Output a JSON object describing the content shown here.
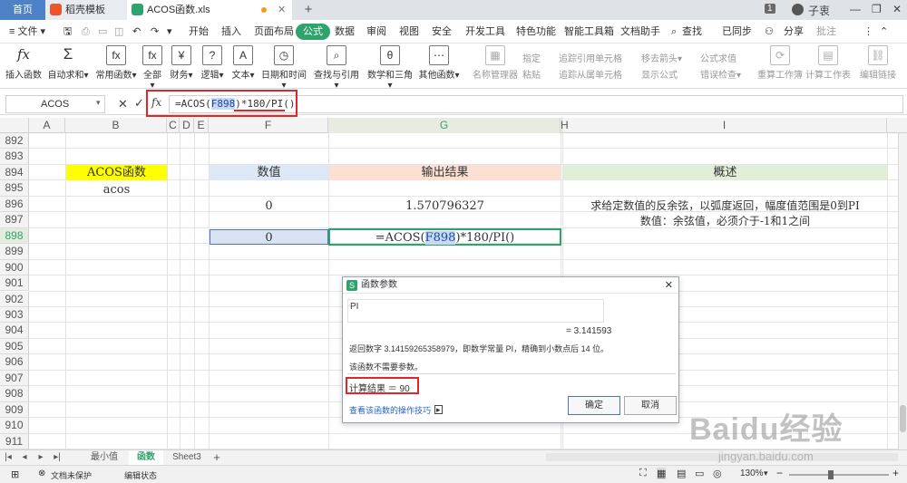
{
  "tabs": {
    "home": "首页",
    "template": "稻壳模板",
    "file": "ACOS函数.xls",
    "add": "+"
  },
  "window": {
    "page_num": "1",
    "user": "子衷"
  },
  "menu": {
    "file": "≡ 文件 ▾",
    "items": [
      "开始",
      "插入",
      "页面布局",
      "公式",
      "数据",
      "审阅",
      "视图",
      "安全",
      "开发工具",
      "特色功能",
      "智能工具箱",
      "文档助手"
    ],
    "active": "公式",
    "search": "查找",
    "sync": "已同步",
    "share": "分享",
    "comment": "批注"
  },
  "ribbon": {
    "buttons": [
      "插入函数",
      "自动求和▾",
      "常用函数▾",
      "全部▾",
      "财务▾",
      "逻辑▾",
      "文本▾",
      "日期和时间▾",
      "查找与引用▾",
      "数学和三角▾",
      "其他函数▾"
    ],
    "name_manager": "名称管理器",
    "paste": "粘贴",
    "specify": "指定",
    "trace_precedents": "追踪引用单元格",
    "trace_dependents": "追踪从属单元格",
    "remove_arrows": "移去箭头▾",
    "show_formula": "显示公式",
    "formula_eval": "公式求值",
    "error_check": "错误检查▾",
    "recalc_book": "重算工作簿",
    "calc_sheet": "计算工作表",
    "edit_links": "编辑链接"
  },
  "formula_bar": {
    "namebox": "ACOS",
    "fx": "fx",
    "formula_prefix": "=ACOS(",
    "formula_ref": "F898",
    "formula_suffix": ")*180/PI()"
  },
  "columns": [
    "A",
    "B",
    "C",
    "D",
    "E",
    "F",
    "G",
    "H",
    "I"
  ],
  "rows": [
    "892",
    "893",
    "894",
    "895",
    "896",
    "897",
    "898",
    "899",
    "900",
    "901",
    "902",
    "903",
    "904",
    "905",
    "906",
    "907",
    "908",
    "909",
    "910",
    "911"
  ],
  "cells": {
    "b894": "ACOS函数",
    "b895": "acos",
    "f894": "数值",
    "g894": "输出结果",
    "i894": "概述",
    "f896": "0",
    "g896": "1.570796327",
    "i896": "求给定数值的反余弦，以弧度返回，幅度值范围是0到PI",
    "i897": "数值：余弦值，必须介于-1和1之间",
    "f898": "0",
    "g898_prefix": "=ACOS(",
    "g898_ref": "F898",
    "g898_suffix": ")*180/PI()"
  },
  "dialog": {
    "title": "函数参数",
    "arg_label": "PI",
    "arg_value": "= 3.141593",
    "desc": "返回数字 3.14159265358979，即数学常量 PI，精确到小数点后 14 位。",
    "note": "该函数不需要参数。",
    "result": "计算结果 ＝ 90",
    "help_link": "查看该函数的操作技巧",
    "ok": "确定",
    "cancel": "取消"
  },
  "sheets": [
    "最小值",
    "函数",
    "Sheet3"
  ],
  "active_sheet": "函数",
  "status": {
    "protect": "文档未保护",
    "mode": "编辑状态",
    "zoom": "130%"
  },
  "watermark": {
    "main": "Baidu经验",
    "url": "jingyan.baidu.com"
  },
  "colors": {
    "accent_green": "#2ea36b",
    "title_yellow": "#ffff00",
    "header_blue": "#dce8f5",
    "header_peach": "#fbe0d3",
    "header_green": "#e2efd8",
    "annotation_red": "#e0262b",
    "selected_blue": "#d9e2f2"
  }
}
